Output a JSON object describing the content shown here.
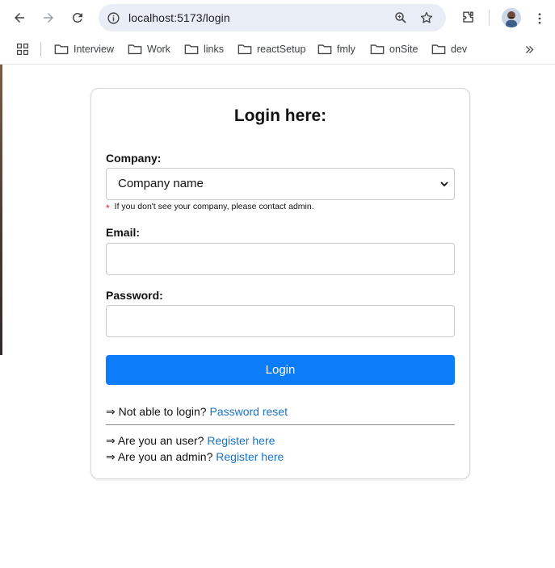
{
  "browser": {
    "url": "localhost:5173/login",
    "icons": {
      "back": "arrow-left-icon",
      "forward": "arrow-right-icon",
      "reload": "reload-icon",
      "info": "info-icon",
      "zoom": "zoom-icon",
      "star": "star-icon",
      "extensions": "puzzle-icon",
      "menu": "kebab-icon"
    }
  },
  "bookmarks": {
    "items": [
      {
        "label": "Interview"
      },
      {
        "label": "Work"
      },
      {
        "label": "links"
      },
      {
        "label": "reactSetup"
      },
      {
        "label": "fmly"
      },
      {
        "label": "onSite"
      },
      {
        "label": "dev"
      }
    ]
  },
  "login": {
    "title": "Login here:",
    "company_label": "Company:",
    "company_selected": "Company name",
    "company_hint_mark": "*",
    "company_hint": "If you don't see your company, please contact admin.",
    "email_label": "Email:",
    "email_value": "",
    "password_label": "Password:",
    "password_value": "",
    "submit_label": "Login",
    "reset_prefix": "⇒ Not able to login?",
    "reset_link": "Password reset",
    "user_prefix": "⇒ Are you an user?",
    "user_link": "Register here",
    "admin_prefix": "⇒ Are you an admin?",
    "admin_link": "Register here"
  },
  "colors": {
    "accent": "#0d7cf8",
    "link": "#1a73c8",
    "required": "#e02020",
    "address_bar": "#e9edf6"
  }
}
